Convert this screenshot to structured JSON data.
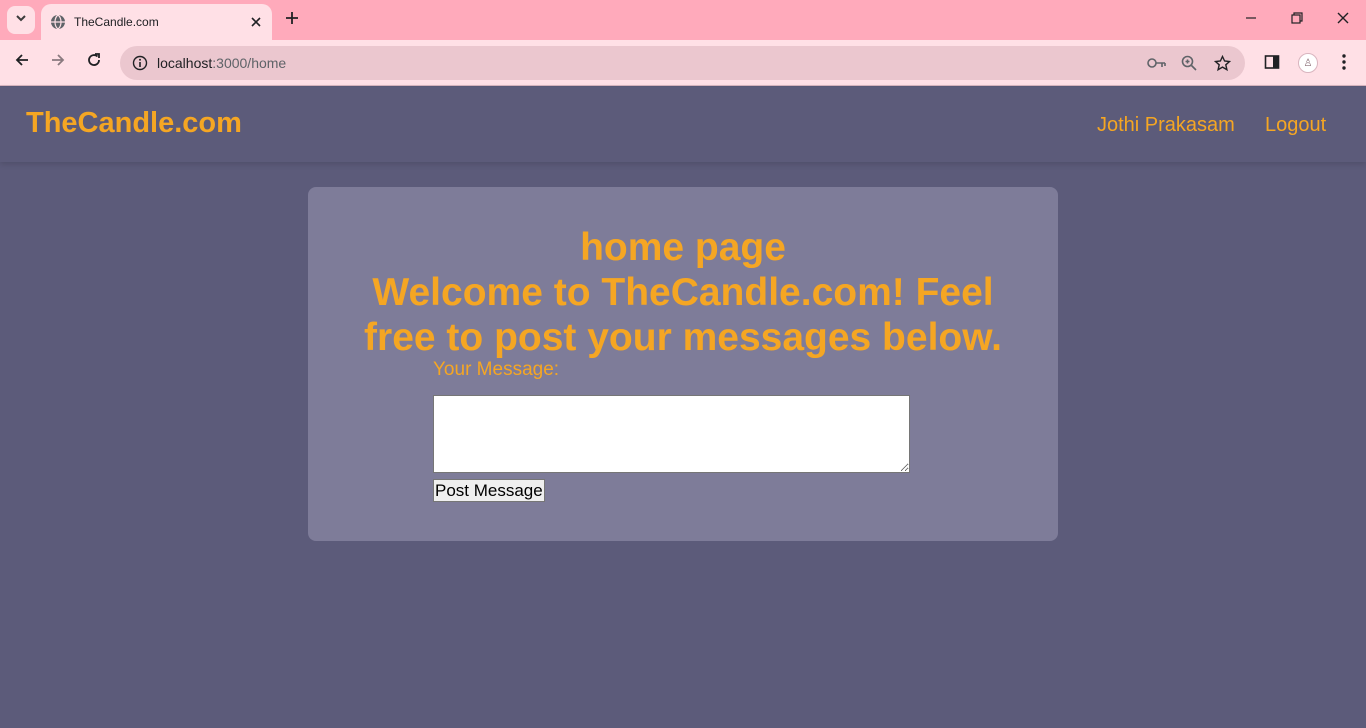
{
  "browser": {
    "tab": {
      "title": "TheCandle.com"
    },
    "address": {
      "host": "localhost",
      "path": ":3000/home"
    }
  },
  "header": {
    "brand": "TheCandle.com",
    "nav": {
      "user": "Jothi Prakasam",
      "logout": "Logout"
    }
  },
  "main": {
    "title": "home page",
    "welcome_line1": "Welcome to TheCandle.com! Feel",
    "welcome_line2": "free to post your messages below.",
    "message_label": "Your Message:",
    "message_value": "",
    "post_button": "Post Message"
  },
  "colors": {
    "accent": "#f5a623",
    "page_bg": "#5c5b7a",
    "card_bg": "#7e7c99",
    "tabstrip_bg": "#ffaabb",
    "toolbar_bg": "#ffe0e6"
  }
}
